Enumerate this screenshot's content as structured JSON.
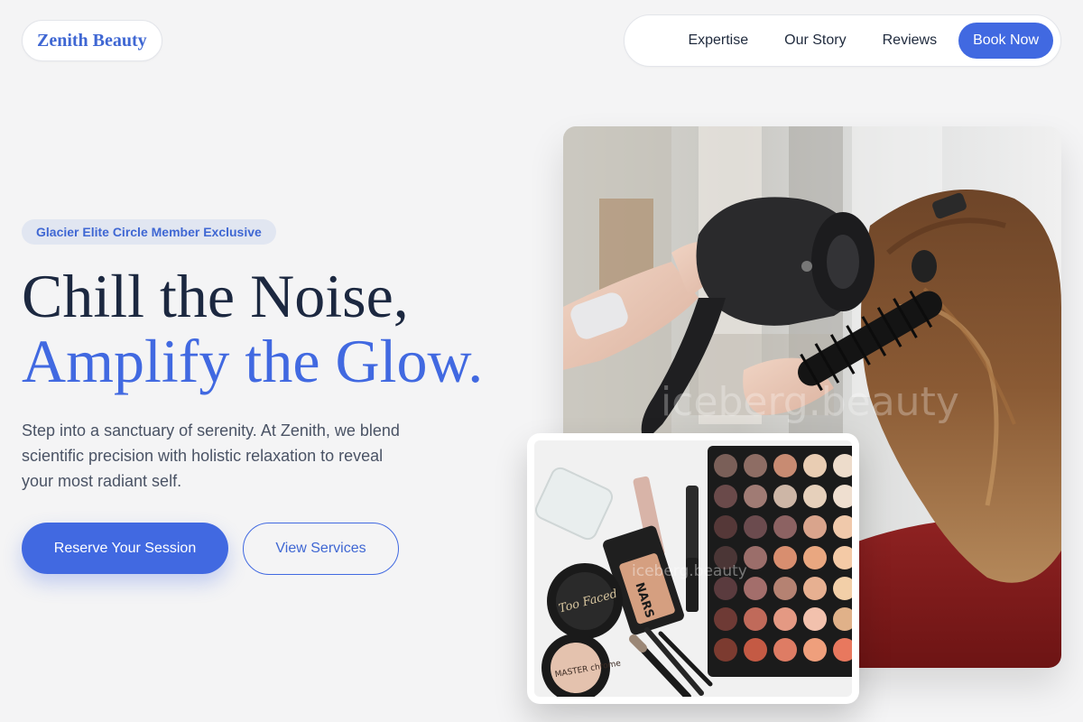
{
  "header": {
    "logo": "Zenith Beauty",
    "nav": {
      "items": [
        "Expertise",
        "Our Story",
        "Reviews"
      ],
      "cta": "Book Now"
    }
  },
  "hero": {
    "badge": "Glacier Elite Circle Member Exclusive",
    "headline_line1": "Chill the Noise,",
    "headline_line2": "Amplify the Glow.",
    "lead": "Step into a sanctuary of serenity. At Zenith, we blend scientific precision with holistic relaxation to reveal your most radiant self.",
    "primary_button": "Reserve Your Session",
    "secondary_button": "View Services"
  },
  "images": {
    "main_photo": {
      "watermark": "iceberg.beauty",
      "depicts": "stylist blow-drying hair with a round brush"
    },
    "inset_photo": {
      "watermark": "iceberg.beauty",
      "depicts": "makeup flat lay with eyeshadow palette",
      "labels": [
        "Too Faced",
        "NARS",
        "MASTER chrome"
      ]
    }
  },
  "colors": {
    "accent": "#4169e1",
    "background": "#f4f4f5",
    "heading": "#1c2840",
    "body_text": "#4a5365",
    "badge_bg": "#e1e6f1"
  }
}
